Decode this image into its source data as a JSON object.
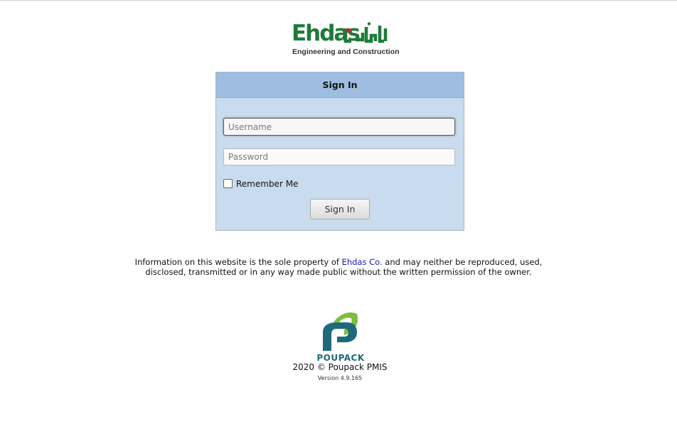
{
  "brand": {
    "name_latin": "Ehdas",
    "tagline": "Engineering and Construction",
    "colors": {
      "green": "#1f7a3a",
      "accent": "#c0282d"
    }
  },
  "signin": {
    "header": "Sign In",
    "username_placeholder": "Username",
    "password_placeholder": "Password",
    "remember_label": "Remember Me",
    "button_label": "Sign In",
    "colors": {
      "header_bg": "#9ebde0",
      "panel_bg": "#c9dbee"
    }
  },
  "notice": {
    "text_before": "Information on this website is the sole property of ",
    "company_link": "Ehdas Co.",
    "text_after": " and may neither be reproduced, used, disclosed, transmitted or in any way made public without the written permission of the owner.",
    "link_color": "#1a1ab8"
  },
  "footer": {
    "product_name": "POUPACK",
    "copyright": "2020 © Poupack PMIS",
    "version": "Version 4.9.165",
    "logo_icon": "poupack-logo-icon"
  }
}
